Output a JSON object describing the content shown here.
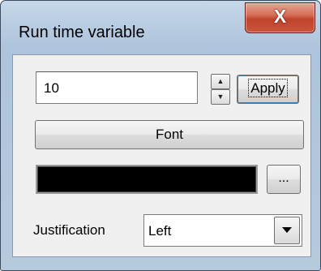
{
  "window": {
    "title": "Run time variable",
    "close_glyph": "X"
  },
  "value_field": {
    "value": "10"
  },
  "spinner": {
    "up_icon": "triangle-up",
    "down_icon": "triangle-down"
  },
  "buttons": {
    "apply_label": "Apply",
    "font_label": "Font",
    "browse_label": "..."
  },
  "color": {
    "swatch": "#000000"
  },
  "justification": {
    "label": "Justification",
    "selected": "Left"
  }
}
